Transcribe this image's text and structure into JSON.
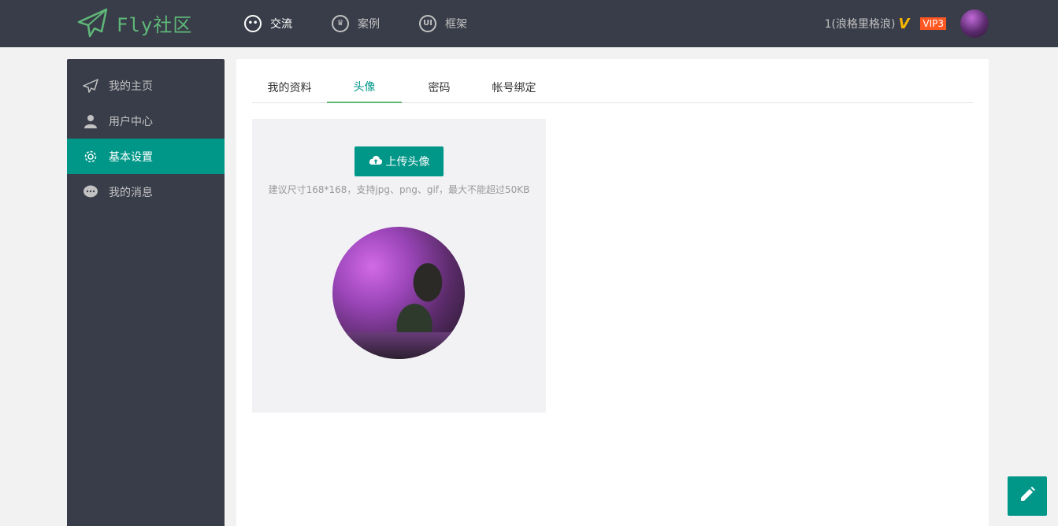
{
  "brand": {
    "logo_text": "Fly社区",
    "accent": "#5fb878"
  },
  "nav": {
    "items": [
      {
        "label": "交流",
        "icon": "chat-bubble-icon",
        "active": true
      },
      {
        "label": "案例",
        "icon": "crown-icon",
        "active": false
      },
      {
        "label": "框架",
        "icon": "ui-icon",
        "active": false
      }
    ]
  },
  "user": {
    "name": "1(浪格里格浪)",
    "verified_mark": "V",
    "vip": "VIP3",
    "avatar_icon": "user-avatar"
  },
  "sidebar": {
    "items": [
      {
        "label": "我的主页",
        "icon": "paper-plane-icon",
        "active": false
      },
      {
        "label": "用户中心",
        "icon": "user-icon",
        "active": false
      },
      {
        "label": "基本设置",
        "icon": "gear-icon",
        "active": true
      },
      {
        "label": "我的消息",
        "icon": "message-icon",
        "active": false
      }
    ]
  },
  "tabs": [
    {
      "label": "我的资料",
      "active": false
    },
    {
      "label": "头像",
      "active": true
    },
    {
      "label": "密码",
      "active": false
    },
    {
      "label": "帐号绑定",
      "active": false
    }
  ],
  "avatar_panel": {
    "upload_label": "上传头像",
    "upload_icon": "cloud-upload-icon",
    "tip": "建议尺寸168*168，支持jpg、png、gif，最大不能超过50KB"
  },
  "float_button": {
    "icon": "pencil-icon"
  },
  "colors": {
    "header_bg": "#393d49",
    "primary": "#009688",
    "vip": "#ff5722",
    "verified": "#f7b500"
  }
}
